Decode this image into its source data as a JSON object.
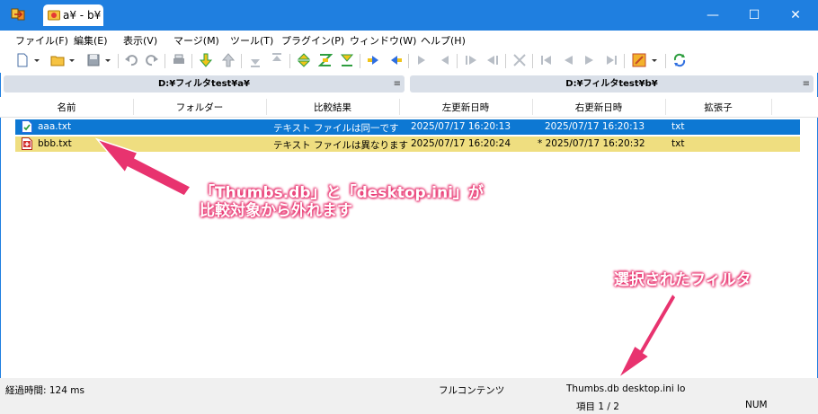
{
  "window": {
    "tab_title": "a¥ - b¥",
    "minimize": "—",
    "maximize": "☐",
    "close": "✕"
  },
  "menu": [
    "ファイル(F)",
    "編集(E)",
    "表示(V)",
    "マージ(M)",
    "ツール(T)",
    "プラグイン(P)",
    "ウィンドウ(W)",
    "ヘルプ(H)"
  ],
  "panes": {
    "left": "D:¥フィルタtest¥a¥",
    "right": "D:¥フィルタtest¥b¥",
    "menu_glyph": "≡"
  },
  "columns": [
    "名前",
    "フォルダー",
    "比較結果",
    "左更新日時",
    "右更新日時",
    "拡張子"
  ],
  "rows": [
    {
      "name": "aaa.txt",
      "folder": "",
      "result": "テキスト ファイルは同一です",
      "left_date": "2025/07/17 16:20:13",
      "right_date": "2025/07/17 16:20:13",
      "ext": "txt",
      "icon": "file-equal-icon"
    },
    {
      "name": "bbb.txt",
      "folder": "",
      "result": "テキスト ファイルは異なります",
      "left_date": "2025/07/17 16:20:24",
      "right_date": "* 2025/07/17 16:20:32",
      "ext": "txt",
      "icon": "file-diff-icon"
    }
  ],
  "annotations": {
    "note1_line1": "「Thumbs.db」と「desktop.ini」が",
    "note1_line2": "比較対象から外れます",
    "note2": "選択されたフィルタ"
  },
  "status": {
    "elapsed": "経過時間: 124 ms",
    "compare_method": "フルコンテンツ",
    "filter": "Thumbs.db desktop.ini lo",
    "items": "項目 1 / 2",
    "numlock": "NUM"
  },
  "colors": {
    "titlebar": "#1f7fe0",
    "selected_row": "#0d78d3",
    "diff_row": "#efde80",
    "callout": "#e8336f"
  }
}
